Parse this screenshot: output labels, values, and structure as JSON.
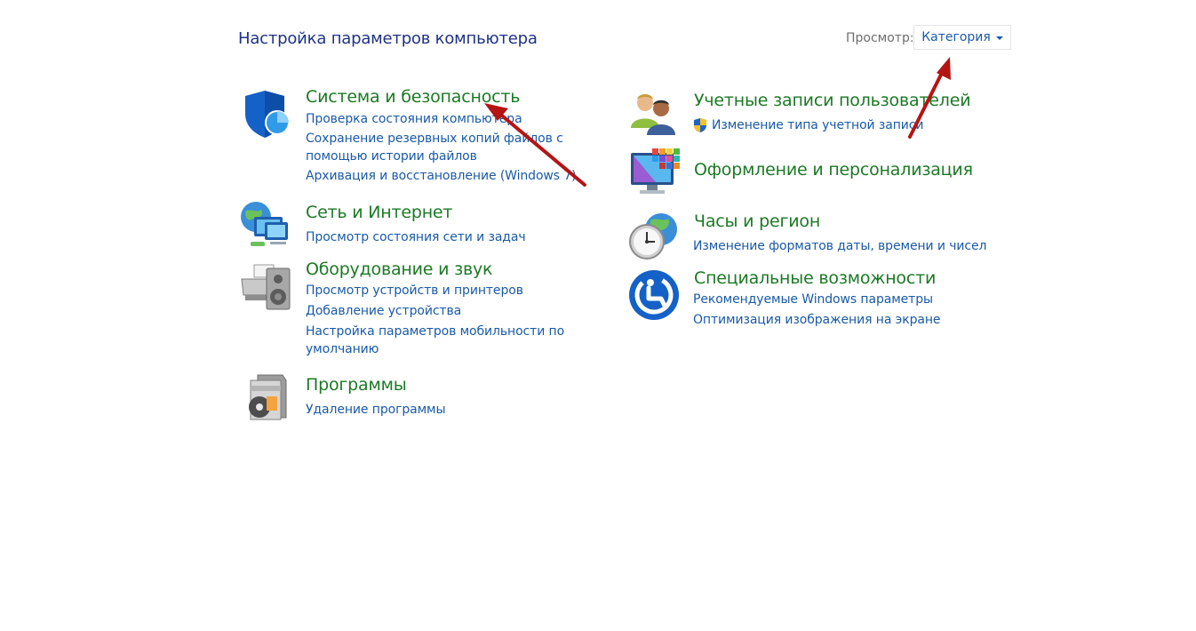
{
  "header": {
    "title": "Настройка параметров компьютера",
    "view_label": "Просмотр:",
    "view_value": "Категория"
  },
  "categories": {
    "system": {
      "title": "Система и безопасность",
      "icon": "shield-icon",
      "links": [
        "Проверка состояния компьютера",
        "Сохранение резервных копий файлов с помощью истории файлов",
        "Архивация и восстановление (Windows 7)"
      ]
    },
    "network": {
      "title": "Сеть и Интернет",
      "icon": "network-globe-icon",
      "links": [
        "Просмотр состояния сети и задач"
      ]
    },
    "hardware": {
      "title": "Оборудование и звук",
      "icon": "printer-speaker-icon",
      "links": [
        "Просмотр устройств и принтеров",
        "Добавление устройства",
        "Настройка параметров мобильности по умолчанию"
      ]
    },
    "programs": {
      "title": "Программы",
      "icon": "programs-disc-icon",
      "links": [
        "Удаление программы"
      ]
    },
    "accounts": {
      "title": "Учетные записи пользователей",
      "icon": "users-icon",
      "links": [
        "Изменение типа учетной записи"
      ]
    },
    "appearance": {
      "title": "Оформление и персонализация",
      "icon": "monitor-palette-icon",
      "links": []
    },
    "clock": {
      "title": "Часы и регион",
      "icon": "clock-globe-icon",
      "links": [
        "Изменение форматов даты, времени и чисел"
      ]
    },
    "access": {
      "title": "Специальные возможности",
      "icon": "ease-of-access-icon",
      "links": [
        "Рекомендуемые Windows параметры",
        "Оптимизация изображения на экране"
      ]
    }
  },
  "colors": {
    "title_blue": "#1e3287",
    "category_green": "#1b7a24",
    "link_blue": "#1a5aa8",
    "annotation_arrow": "#b51414"
  }
}
